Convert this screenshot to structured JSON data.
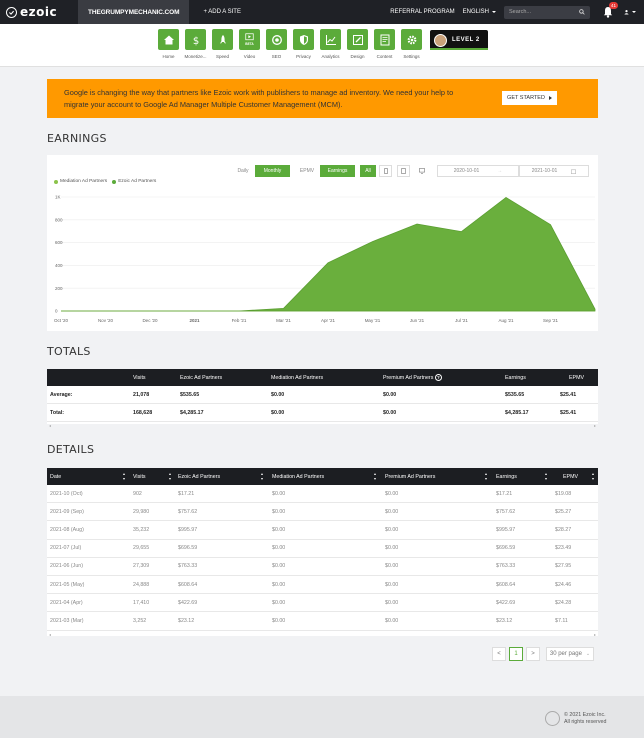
{
  "topbar": {
    "logo_text": "ezoic",
    "site_name": "THEGRUMPYMECHANIC.COM",
    "add_site": "+ ADD A SITE",
    "referral": "REFERRAL PROGRAM",
    "language": "ENGLISH",
    "search_placeholder": "Search...",
    "notification_count": "41"
  },
  "nav": {
    "items": [
      {
        "label": "Home",
        "icon": "home-icon"
      },
      {
        "label": "Monetize...",
        "icon": "dollar-icon"
      },
      {
        "label": "Speed",
        "icon": "rocket-icon"
      },
      {
        "label": "Video",
        "icon": "video-icon"
      },
      {
        "label": "SEO",
        "icon": "seo-icon"
      },
      {
        "label": "Privacy",
        "icon": "shield-icon"
      },
      {
        "label": "Analytics",
        "icon": "chart-icon"
      },
      {
        "label": "Design",
        "icon": "pencil-icon"
      },
      {
        "label": "Content",
        "icon": "document-icon"
      },
      {
        "label": "Settings",
        "icon": "gear-icon"
      }
    ],
    "video_badge": "BETA",
    "level_label": "LEVEL 2"
  },
  "banner": {
    "text": "Google is changing the way that partners like Ezoic work with publishers to manage ad inventory. We need your help to migrate your account to Google Ad Manager Multiple Customer Management (MCM).",
    "button": "GET STARTED"
  },
  "earnings": {
    "title": "EARNINGS",
    "controls": {
      "daily": "Daily",
      "monthly": "Monthly",
      "epmv": "EPMV",
      "earnings": "Earnings",
      "all": "All",
      "start_date": "2020-10-01",
      "end_date": "2021-10-01"
    },
    "legend": [
      "Mediation Ad Partners",
      "Ezoic Ad Partners"
    ]
  },
  "chart_data": {
    "type": "area",
    "categories": [
      "Oct '20",
      "Nov '20",
      "Dec '20",
      "2021",
      "Feb '21",
      "Mar '21",
      "Apr '21",
      "May '21",
      "Jun '21",
      "Jul '21",
      "Aug '21",
      "Sep '21",
      "Oct '21"
    ],
    "x_ticks": [
      "Oct '20",
      "Nov '20",
      "Dec '20",
      "2021",
      "Feb '21",
      "Mar '21",
      "Apr '21",
      "May '21",
      "Jun '21",
      "Jul '21",
      "Aug '21",
      "Sep '21"
    ],
    "series": [
      {
        "name": "Mediation Ad Partners",
        "color": "#8bc34a",
        "values": [
          0,
          0,
          0,
          0,
          0,
          0,
          0,
          0,
          0,
          0,
          0,
          0,
          0
        ]
      },
      {
        "name": "Ezoic Ad Partners",
        "color": "#6aaf3d",
        "values": [
          0,
          0,
          0,
          0,
          0,
          23.12,
          422.69,
          608.64,
          763.33,
          696.59,
          995.97,
          757.62,
          17.21
        ]
      }
    ],
    "y_ticks": [
      "0",
      "200",
      "400",
      "600",
      "800",
      "1K"
    ],
    "ylim": [
      0,
      1000
    ],
    "grid": true
  },
  "totals": {
    "title": "TOTALS",
    "headers": [
      "",
      "Visits",
      "Ezoic Ad Partners",
      "Mediation Ad Partners",
      "Premium Ad Partners",
      "Earnings",
      "EPMV"
    ],
    "help_icon": "?",
    "rows": [
      [
        "Average:",
        "21,078",
        "$535.65",
        "$0.00",
        "$0.00",
        "$535.65",
        "$25.41"
      ],
      [
        "Total:",
        "168,628",
        "$4,285.17",
        "$0.00",
        "$0.00",
        "$4,285.17",
        "$25.41"
      ]
    ]
  },
  "details": {
    "title": "DETAILS",
    "headers": [
      "Date",
      "Visits",
      "Ezoic Ad Partners",
      "Mediation Ad Partners",
      "Premium Ad Partners",
      "Earnings",
      "EPMV"
    ],
    "rows": [
      [
        "2021-10 (Oct)",
        "902",
        "$17.21",
        "$0.00",
        "$0.00",
        "$17.21",
        "$19.08"
      ],
      [
        "2021-09 (Sep)",
        "29,980",
        "$757.62",
        "$0.00",
        "$0.00",
        "$757.62",
        "$25.27"
      ],
      [
        "2021-08 (Aug)",
        "35,232",
        "$995.97",
        "$0.00",
        "$0.00",
        "$995.97",
        "$28.27"
      ],
      [
        "2021-07 (Jul)",
        "29,655",
        "$696.59",
        "$0.00",
        "$0.00",
        "$696.59",
        "$23.49"
      ],
      [
        "2021-06 (Jun)",
        "27,309",
        "$763.33",
        "$0.00",
        "$0.00",
        "$763.33",
        "$27.95"
      ],
      [
        "2021-05 (May)",
        "24,888",
        "$608.64",
        "$0.00",
        "$0.00",
        "$608.64",
        "$24.46"
      ],
      [
        "2021-04 (Apr)",
        "17,410",
        "$422.69",
        "$0.00",
        "$0.00",
        "$422.69",
        "$24.28"
      ],
      [
        "2021-03 (Mar)",
        "3,252",
        "$23.12",
        "$0.00",
        "$0.00",
        "$23.12",
        "$7.11"
      ]
    ],
    "pagination": {
      "prev": "<",
      "current": "1",
      "next": ">",
      "per_page": "30 per page"
    }
  },
  "footer": {
    "copyright": "© 2021 Ezoic Inc.",
    "rights": "All rights reserved"
  },
  "colors": {
    "accent": "#5bab3a",
    "banner": "#ff9900",
    "topbar": "#1f2126"
  }
}
